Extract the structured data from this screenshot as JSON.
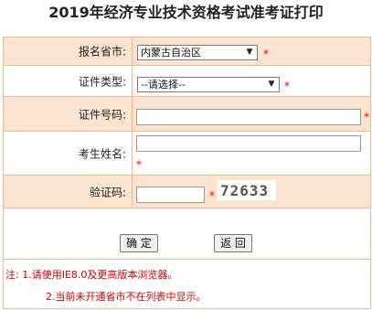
{
  "page": {
    "title": "2019年经济专业技术资格考试准考证打印"
  },
  "form": {
    "province": {
      "label": "报名省市:",
      "value": "内蒙古自治区"
    },
    "id_type": {
      "label": "证件类型:",
      "value": "--请选择--"
    },
    "id_number": {
      "label": "证件号码:",
      "value": ""
    },
    "name": {
      "label": "考生姓名:",
      "value": ""
    },
    "captcha": {
      "label": "验证码:",
      "value": "",
      "code": "72633"
    },
    "required_mark": "*"
  },
  "buttons": {
    "confirm": "确 定",
    "back": "返 回"
  },
  "notes": {
    "line1": "注: 1.请使用IE8.0及更高版本浏览器。",
    "line2": "2.当前未开通省市不在列表中显示。"
  },
  "colors": {
    "border": "#f3b78b",
    "shade": "#fbe4d0",
    "required": "#e00000",
    "note": "#d40000"
  }
}
